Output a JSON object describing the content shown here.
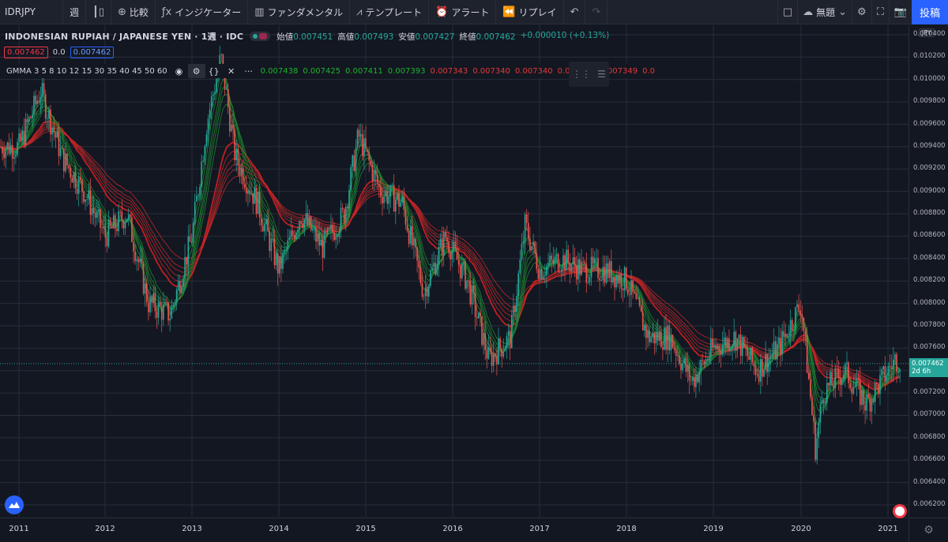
{
  "toolbar": {
    "symbol": "IDRJPY",
    "interval": "週",
    "compare": "比較",
    "indicators": "インジケーター",
    "fundamentals": "ファンダメンタル",
    "templates": "テンプレート",
    "alert": "アラート",
    "replay": "リプレイ",
    "layout_name": "無題",
    "publish": "投稿"
  },
  "legend": {
    "title": "INDONESIAN RUPIAH / JAPANESE YEN",
    "interval": "1週",
    "source": "IDC",
    "open_label": "始値",
    "open": "0.007451",
    "high_label": "高値",
    "high": "0.007493",
    "low_label": "安値",
    "low": "0.007427",
    "close_label": "終値",
    "close": "0.007462",
    "change": "+0.000010 (+0.13%)",
    "bid": "0.007462",
    "spread": "0.0",
    "ask": "0.007462"
  },
  "indicator": {
    "name": "GMMA 3 5 8 10 12 15 30 35 40 45 50 60",
    "values_green": [
      "0.007438",
      "0.007425",
      "0.007411",
      "0.007393"
    ],
    "values_red": [
      "0.007343",
      "0.007340",
      "0.007340",
      "0.007344",
      "0.007349",
      "0.0"
    ]
  },
  "price_axis": {
    "currency": "JPY",
    "labels": [
      "0.010400",
      "0.010200",
      "0.010000",
      "0.009800",
      "0.009600",
      "0.009400",
      "0.009200",
      "0.009000",
      "0.008800",
      "0.008600",
      "0.008400",
      "0.008200",
      "0.008000",
      "0.007800",
      "0.007600",
      "0.007400",
      "0.007200",
      "0.007000",
      "0.006800",
      "0.006600",
      "0.006400",
      "0.006200"
    ],
    "current_price": "0.007462",
    "countdown": "2d 6h"
  },
  "time_axis": {
    "labels": [
      "2011",
      "2012",
      "2013",
      "2014",
      "2015",
      "2016",
      "2017",
      "2018",
      "2019",
      "2020",
      "2021"
    ]
  },
  "colors": {
    "background": "#131722",
    "up": "#26a69a",
    "down": "#ef5350",
    "gmma_short": "#1b8a2e",
    "gmma_long": "#c62828",
    "accent": "#2962ff"
  },
  "chart_data": {
    "type": "line",
    "series": [
      {
        "x": [
          "2010-10",
          "2011-01",
          "2011-04",
          "2011-07",
          "2011-10",
          "2012-01",
          "2012-04",
          "2012-07",
          "2012-10",
          "2013-01",
          "2013-03",
          "2013-05",
          "2013-07",
          "2013-10",
          "2014-01",
          "2014-04",
          "2014-07",
          "2014-10",
          "2014-12",
          "2015-03",
          "2015-06",
          "2015-09",
          "2015-12",
          "2016-03",
          "2016-06",
          "2016-09",
          "2016-11",
          "2017-01",
          "2017-04",
          "2017-07",
          "2017-10",
          "2018-01",
          "2018-04",
          "2018-07",
          "2018-10",
          "2019-01",
          "2019-04",
          "2019-07",
          "2019-10",
          "2020-01",
          "2020-03",
          "2020-04",
          "2020-07",
          "2020-10",
          "2021-01",
          "2021-02"
        ],
        "values": [
          0.0094,
          0.0094,
          0.0099,
          0.0093,
          0.009,
          0.0086,
          0.0088,
          0.008,
          0.0079,
          0.0086,
          0.0096,
          0.0102,
          0.0093,
          0.0089,
          0.0083,
          0.0088,
          0.0085,
          0.0088,
          0.0095,
          0.009,
          0.0089,
          0.0081,
          0.0086,
          0.0082,
          0.0075,
          0.0077,
          0.0087,
          0.0083,
          0.0084,
          0.0083,
          0.0083,
          0.0082,
          0.0077,
          0.0077,
          0.0073,
          0.0076,
          0.0077,
          0.0074,
          0.0076,
          0.008,
          0.0067,
          0.0072,
          0.0074,
          0.0071,
          0.0074,
          0.0075
        ]
      }
    ],
    "ylim": [
      0.0062,
      0.0104
    ]
  }
}
